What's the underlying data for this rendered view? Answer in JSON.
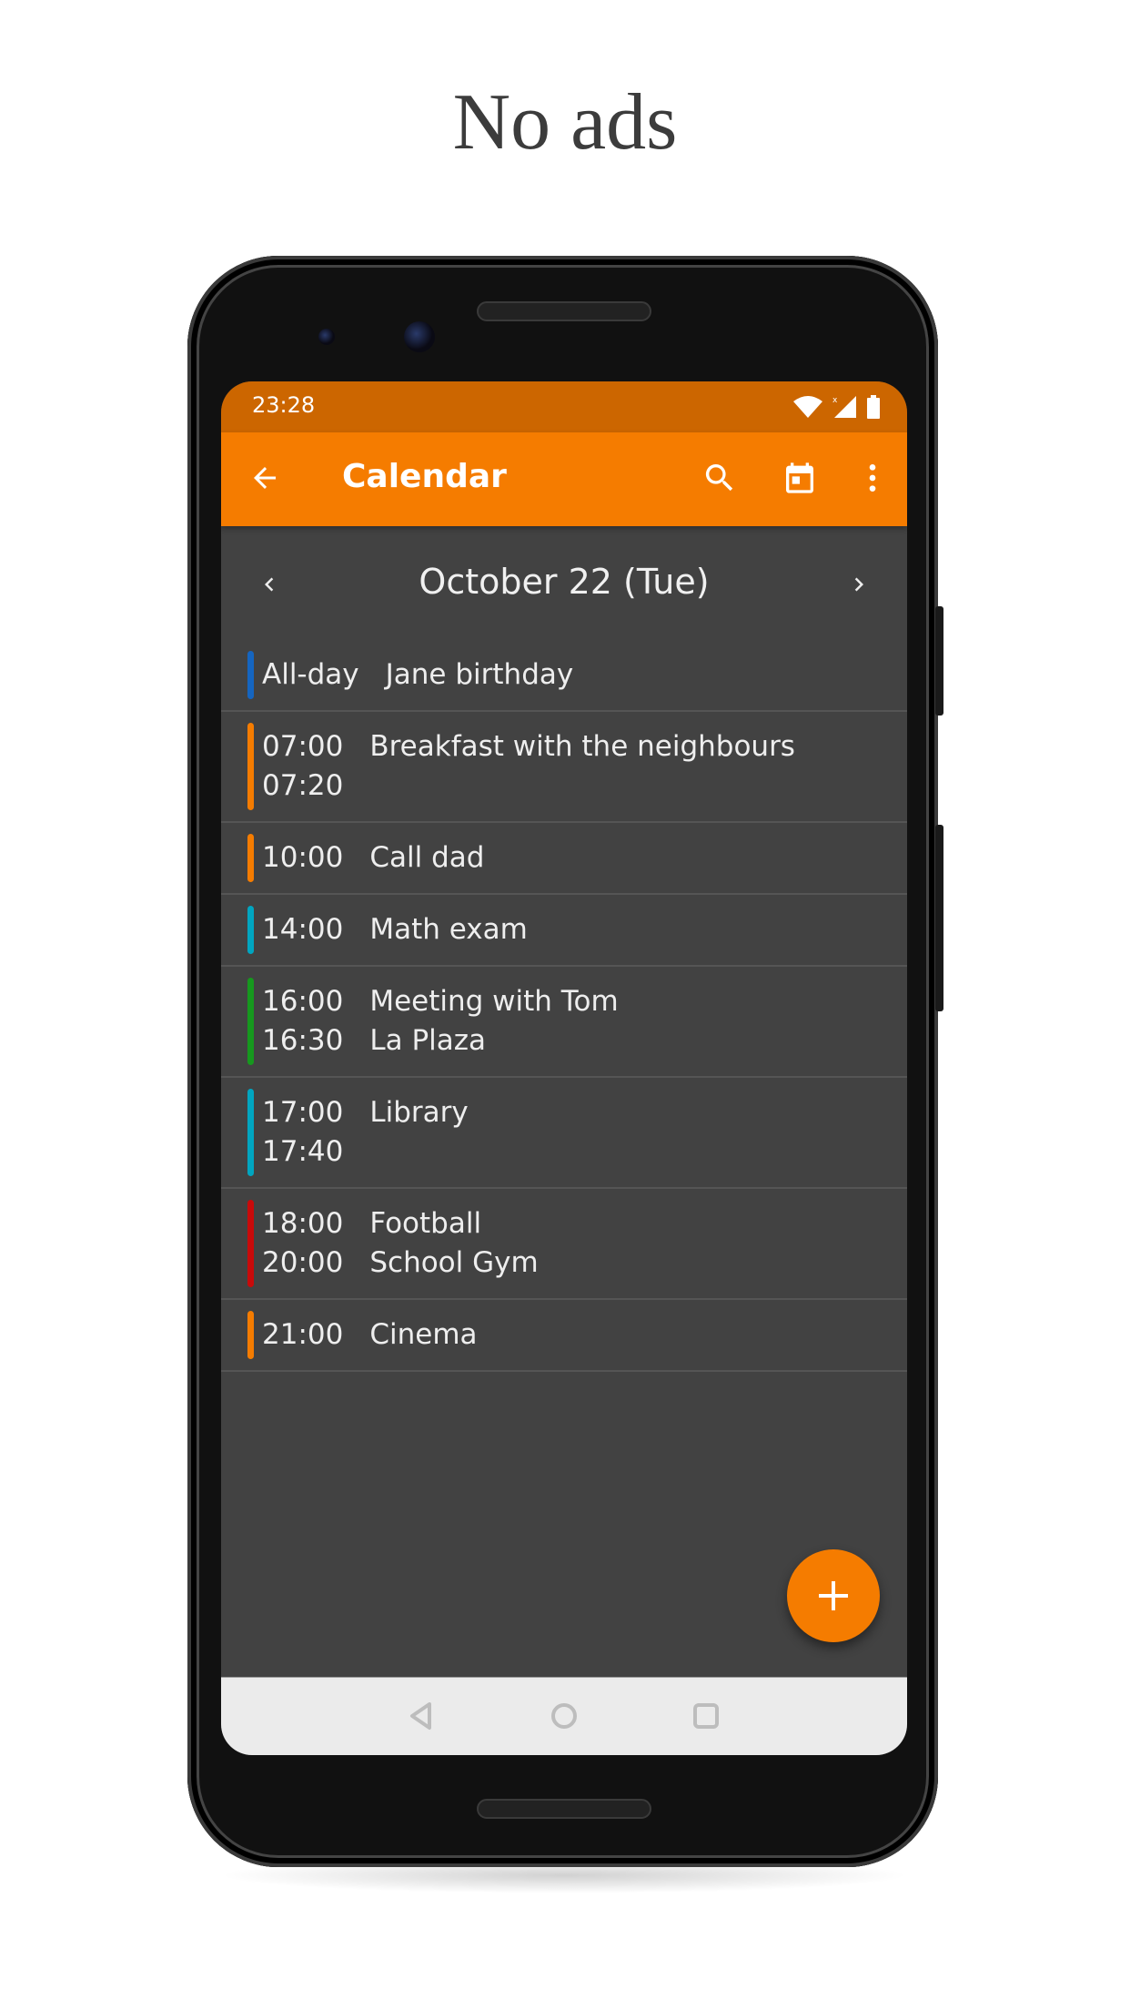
{
  "headline": "No ads",
  "status_bar": {
    "time": "23:28",
    "icons": [
      "wifi-icon",
      "signal-icon",
      "battery-icon"
    ]
  },
  "toolbar": {
    "title": "Calendar",
    "icons": [
      "back-arrow-icon",
      "search-icon",
      "calendar-today-icon",
      "more-vert-icon"
    ]
  },
  "date_nav": {
    "title": "October 22 (Tue)"
  },
  "events": [
    {
      "start": "All-day",
      "end": "",
      "title": "Jane birthday",
      "location": "",
      "color": "#1565c0"
    },
    {
      "start": "07:00",
      "end": "07:20",
      "title": "Breakfast with the neighbours",
      "location": "",
      "color": "#f57c00"
    },
    {
      "start": "10:00",
      "end": "",
      "title": "Call dad",
      "location": "",
      "color": "#f57c00"
    },
    {
      "start": "14:00",
      "end": "",
      "title": "Math exam",
      "location": "",
      "color": "#00a5c0"
    },
    {
      "start": "16:00",
      "end": "16:30",
      "title": "Meeting with Tom",
      "location": "La Plaza",
      "color": "#16981e"
    },
    {
      "start": "17:00",
      "end": "17:40",
      "title": "Library",
      "location": "",
      "color": "#00a5c0"
    },
    {
      "start": "18:00",
      "end": "20:00",
      "title": "Football",
      "location": "School Gym",
      "color": "#c80a0a"
    },
    {
      "start": "21:00",
      "end": "",
      "title": "Cinema",
      "location": "",
      "color": "#f57c00"
    }
  ],
  "colors": {
    "accent": "#f57c00",
    "status_bar": "#cc6600",
    "background": "#424242"
  }
}
